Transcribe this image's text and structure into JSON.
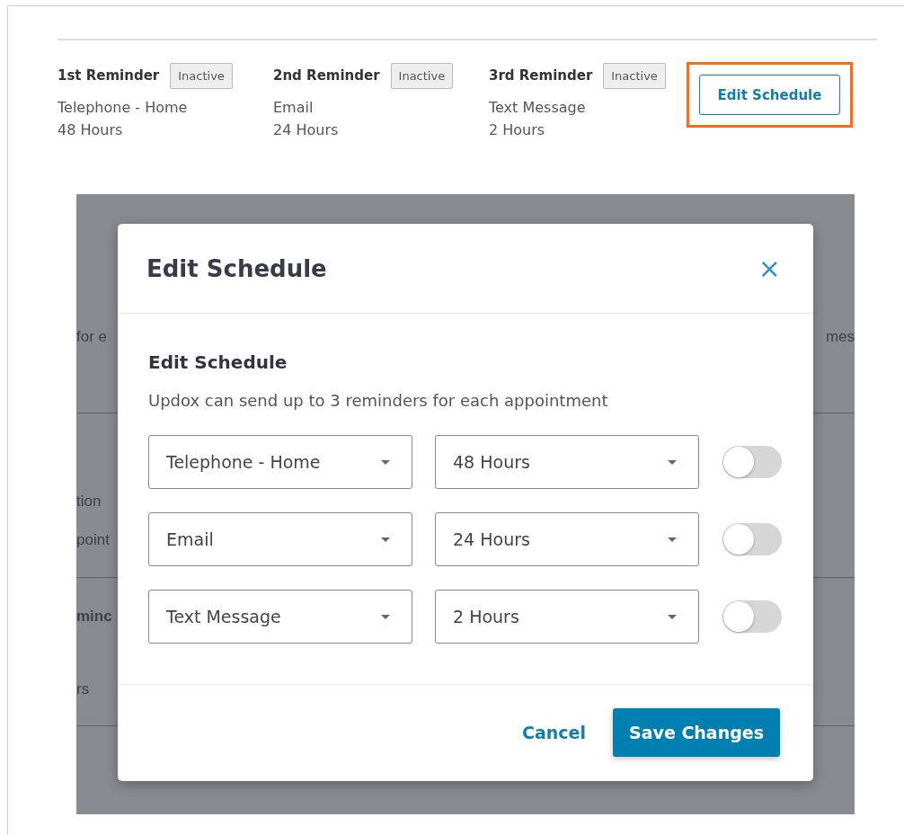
{
  "reminders": [
    {
      "title": "1st Reminder",
      "status": "Inactive",
      "method": "Telephone - Home",
      "lead_time": "48 Hours"
    },
    {
      "title": "2nd Reminder",
      "status": "Inactive",
      "method": "Email",
      "lead_time": "24 Hours"
    },
    {
      "title": "3rd Reminder",
      "status": "Inactive",
      "method": "Text Message",
      "lead_time": "2 Hours"
    }
  ],
  "edit_button": {
    "label": "Edit Schedule",
    "highlighted": true
  },
  "background_left": [
    {
      "text": "for e",
      "bold": false
    },
    {
      "text": "tion",
      "bold": false
    },
    {
      "text": "point",
      "bold": false
    },
    {
      "text": "minc",
      "bold": true
    },
    {
      "text": "rs",
      "bold": false
    }
  ],
  "background_right": [
    {
      "text": "mes",
      "bold": false
    }
  ],
  "modal": {
    "title": "Edit Schedule",
    "close": "×",
    "heading": "Edit Schedule",
    "description": "Updox can send up to 3 reminders for each appointment",
    "rows": [
      {
        "method": "Telephone - Home",
        "lead_time": "48 Hours",
        "on": false
      },
      {
        "method": "Email",
        "lead_time": "24 Hours",
        "on": false
      },
      {
        "method": "Text Message",
        "lead_time": "2 Hours",
        "on": false
      }
    ],
    "cancel": "Cancel",
    "save": "Save Changes"
  }
}
